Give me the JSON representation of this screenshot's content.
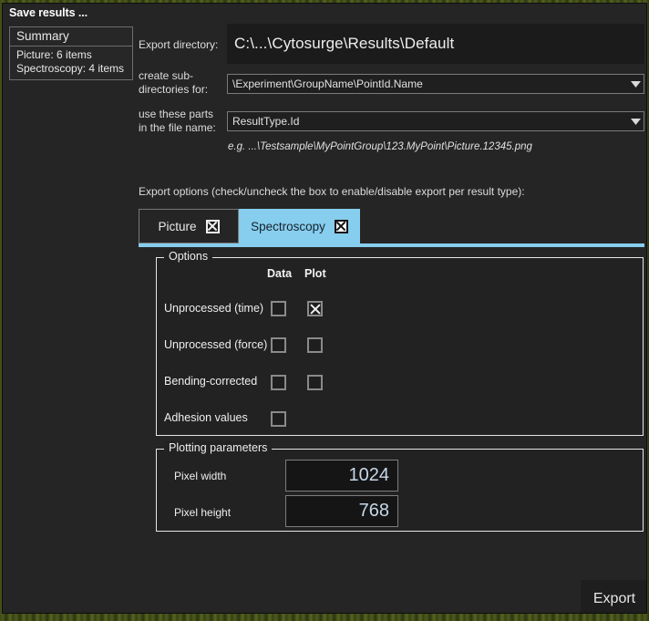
{
  "window": {
    "title": "Save results ..."
  },
  "summary": {
    "header": "Summary",
    "rows": [
      "Picture: 6 items",
      "Spectroscopy: 4 items"
    ]
  },
  "form": {
    "export_directory_label": "Export directory:",
    "export_directory_value": "C:\\...\\Cytosurge\\Results\\Default",
    "subdirectories_label": "create sub-\ndirectories for:",
    "subdirectories_value": "\\Experiment\\GroupName\\PointId.Name",
    "file_name_parts_label": "use these parts\nin the file name:",
    "file_name_parts_value": "ResultType.Id",
    "example_text": "e.g. ...\\Testsample\\MyPointGroup\\123.MyPoint\\Picture.12345.png"
  },
  "export_options": {
    "description": "Export options (check/uncheck the box to enable/disable export per result type):",
    "tabs": [
      {
        "label": "Picture",
        "checked": true,
        "active": false
      },
      {
        "label": "Spectroscopy",
        "checked": true,
        "active": true
      }
    ]
  },
  "options_group": {
    "title": "Options",
    "column_headers": [
      "Data",
      "Plot"
    ],
    "rows": [
      {
        "label": "Unprocessed (time)",
        "data": false,
        "plot": true,
        "has_plot": true
      },
      {
        "label": "Unprocessed (force)",
        "data": false,
        "plot": false,
        "has_plot": true
      },
      {
        "label": "Bending-corrected",
        "data": false,
        "plot": false,
        "has_plot": true
      },
      {
        "label": "Adhesion values",
        "data": false,
        "plot": false,
        "has_plot": false
      }
    ]
  },
  "plotting_parameters": {
    "title": "Plotting parameters",
    "fields": [
      {
        "label": "Pixel width",
        "value": "1024"
      },
      {
        "label": "Pixel height",
        "value": "768"
      }
    ]
  },
  "footer": {
    "export_label": "Export"
  },
  "colors": {
    "accent_blue": "#87cdee",
    "dialog_bg": "#252525",
    "groupbox_bg": "#222222",
    "input_bg": "#1b1b1b",
    "value_blue": "#c5d8ea"
  }
}
